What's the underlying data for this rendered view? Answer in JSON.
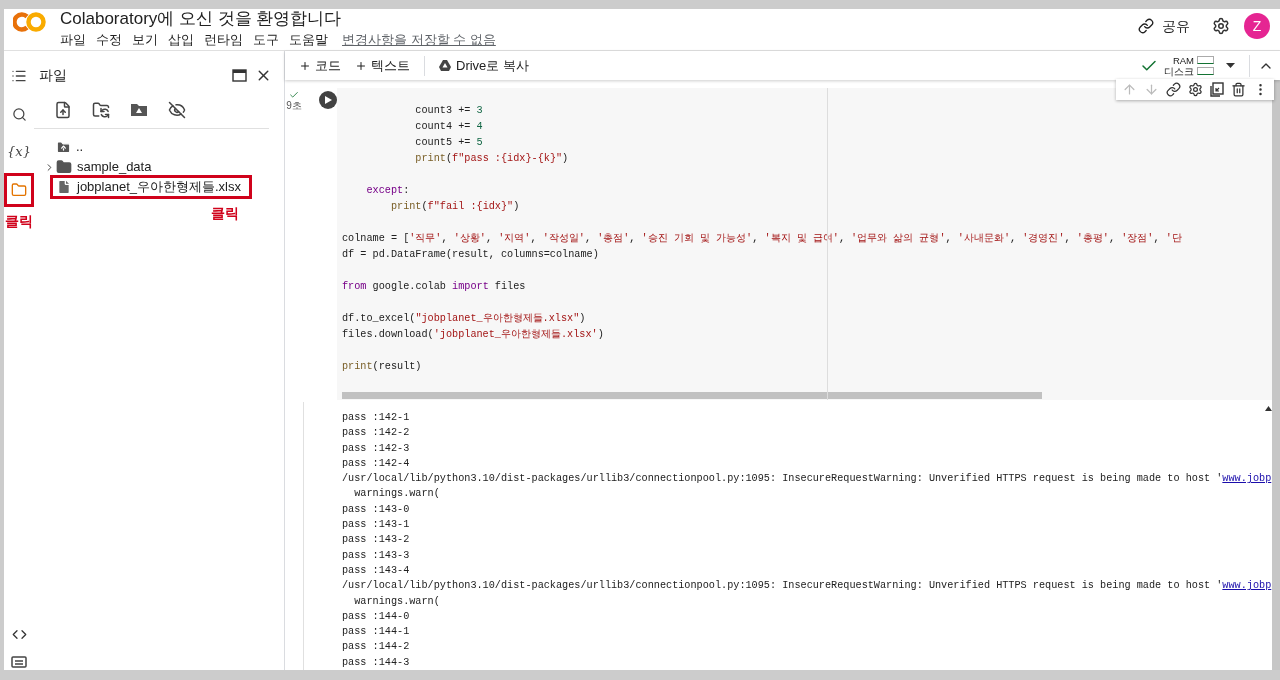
{
  "header": {
    "title": "Colaboratory에 오신 것을 환영합니다",
    "menu": [
      "파일",
      "수정",
      "보기",
      "삽입",
      "런타임",
      "도구",
      "도움말"
    ],
    "save_notice": "변경사항을 저장할 수 없음",
    "share": "공유",
    "avatar": "Z"
  },
  "side_strip": {
    "items": [
      {
        "kind": "toc",
        "selected": false,
        "highlighted": false
      },
      {
        "kind": "search",
        "selected": false,
        "highlighted": false
      },
      {
        "kind": "variables",
        "label": "{x}",
        "selected": false,
        "highlighted": false
      },
      {
        "kind": "files",
        "selected": true,
        "highlighted": true,
        "annotation": "클릭"
      }
    ],
    "bottom": [
      {
        "kind": "code"
      },
      {
        "kind": "terminal"
      }
    ]
  },
  "files_panel": {
    "title": "파일",
    "tree": [
      {
        "kind": "up",
        "name": "..",
        "highlighted": false
      },
      {
        "kind": "folder",
        "name": "sample_data",
        "expanded": false,
        "highlighted": false
      },
      {
        "kind": "file",
        "name": "jobplanet_우아한형제들.xlsx",
        "highlighted": true,
        "annotation": "클릭"
      }
    ]
  },
  "toolbar": {
    "add_code": "코드",
    "add_text": "텍스트",
    "copy_drive": "Drive로 복사",
    "ram": "RAM",
    "disk": "디스크",
    "connected": true
  },
  "cell": {
    "run_time": "9초",
    "done": true,
    "code": [
      {
        "kind": "code",
        "tokens": [
          {
            "kind": "plain",
            "text": "            count3 += "
          },
          {
            "kind": "number",
            "text": "3"
          }
        ]
      },
      {
        "kind": "code",
        "tokens": [
          {
            "kind": "plain",
            "text": "            count4 += "
          },
          {
            "kind": "number",
            "text": "4"
          }
        ]
      },
      {
        "kind": "code",
        "tokens": [
          {
            "kind": "plain",
            "text": "            count5 += "
          },
          {
            "kind": "number",
            "text": "5"
          }
        ]
      },
      {
        "kind": "code",
        "tokens": [
          {
            "kind": "func",
            "text": "            print"
          },
          {
            "kind": "plain",
            "text": "("
          },
          {
            "kind": "string",
            "text": "f\"pass :{idx}-{k}\""
          },
          {
            "kind": "plain",
            "text": ")"
          }
        ]
      },
      {
        "kind": "blank"
      },
      {
        "kind": "code",
        "tokens": [
          {
            "kind": "keyword",
            "text": "    except"
          },
          {
            "kind": "plain",
            "text": ":"
          }
        ]
      },
      {
        "kind": "code",
        "tokens": [
          {
            "kind": "func",
            "text": "        print"
          },
          {
            "kind": "plain",
            "text": "("
          },
          {
            "kind": "string",
            "text": "f\"fail :{idx}\""
          },
          {
            "kind": "plain",
            "text": ")"
          }
        ]
      },
      {
        "kind": "blank"
      },
      {
        "kind": "code",
        "tokens": [
          {
            "kind": "plain",
            "text": "colname = ["
          },
          {
            "kind": "string",
            "text": "'직무'"
          },
          {
            "kind": "plain",
            "text": ", "
          },
          {
            "kind": "string",
            "text": "'상황'"
          },
          {
            "kind": "plain",
            "text": ", "
          },
          {
            "kind": "string",
            "text": "'지역'"
          },
          {
            "kind": "plain",
            "text": ", "
          },
          {
            "kind": "string",
            "text": "'작성일'"
          },
          {
            "kind": "plain",
            "text": ", "
          },
          {
            "kind": "string",
            "text": "'총점'"
          },
          {
            "kind": "plain",
            "text": ", "
          },
          {
            "kind": "string",
            "text": "'승진 기회 및 가능성'"
          },
          {
            "kind": "plain",
            "text": ", "
          },
          {
            "kind": "string",
            "text": "'복지 및 급여'"
          },
          {
            "kind": "plain",
            "text": ", "
          },
          {
            "kind": "string",
            "text": "'업무와 삶의 균형'"
          },
          {
            "kind": "plain",
            "text": ", "
          },
          {
            "kind": "string",
            "text": "'사내문화'"
          },
          {
            "kind": "plain",
            "text": ", "
          },
          {
            "kind": "string",
            "text": "'경영진'"
          },
          {
            "kind": "plain",
            "text": ", "
          },
          {
            "kind": "string",
            "text": "'총평'"
          },
          {
            "kind": "plain",
            "text": ", "
          },
          {
            "kind": "string",
            "text": "'장점'"
          },
          {
            "kind": "plain",
            "text": ", "
          },
          {
            "kind": "string",
            "text": "'단"
          }
        ]
      },
      {
        "kind": "code",
        "tokens": [
          {
            "kind": "plain",
            "text": "df = pd.DataFrame(result, columns=colname)"
          }
        ]
      },
      {
        "kind": "blank"
      },
      {
        "kind": "code",
        "tokens": [
          {
            "kind": "keyword",
            "text": "from"
          },
          {
            "kind": "plain",
            "text": " google.colab "
          },
          {
            "kind": "keyword",
            "text": "import"
          },
          {
            "kind": "plain",
            "text": " files"
          }
        ]
      },
      {
        "kind": "blank"
      },
      {
        "kind": "code",
        "tokens": [
          {
            "kind": "plain",
            "text": "df.to_excel("
          },
          {
            "kind": "string",
            "text": "\"jobplanet_우아한형제들.xlsx\""
          },
          {
            "kind": "plain",
            "text": ")"
          }
        ]
      },
      {
        "kind": "code",
        "tokens": [
          {
            "kind": "plain",
            "text": "files.download("
          },
          {
            "kind": "string",
            "text": "'jobplanet_우아한형제들.xlsx'"
          },
          {
            "kind": "plain",
            "text": ")"
          }
        ]
      },
      {
        "kind": "blank"
      },
      {
        "kind": "code",
        "tokens": [
          {
            "kind": "func",
            "text": "print"
          },
          {
            "kind": "plain",
            "text": "(result)"
          }
        ]
      }
    ]
  },
  "output": [
    {
      "kind": "text",
      "text": "pass :142-1"
    },
    {
      "kind": "text",
      "text": "pass :142-2"
    },
    {
      "kind": "text",
      "text": "pass :142-3"
    },
    {
      "kind": "text",
      "text": "pass :142-4"
    },
    {
      "kind": "warning",
      "text": "/usr/local/lib/python3.10/dist-packages/urllib3/connectionpool.py:1095: InsecureRequestWarning: Unverified HTTPS request is being made to host '",
      "link": "www.jobp"
    },
    {
      "kind": "text",
      "text": "  warnings.warn("
    },
    {
      "kind": "text",
      "text": "pass :143-0"
    },
    {
      "kind": "text",
      "text": "pass :143-1"
    },
    {
      "kind": "text",
      "text": "pass :143-2"
    },
    {
      "kind": "text",
      "text": "pass :143-3"
    },
    {
      "kind": "text",
      "text": "pass :143-4"
    },
    {
      "kind": "warning",
      "text": "/usr/local/lib/python3.10/dist-packages/urllib3/connectionpool.py:1095: InsecureRequestWarning: Unverified HTTPS request is being made to host '",
      "link": "www.jobp"
    },
    {
      "kind": "text",
      "text": "  warnings.warn("
    },
    {
      "kind": "text",
      "text": "pass :144-0"
    },
    {
      "kind": "text",
      "text": "pass :144-1"
    },
    {
      "kind": "text",
      "text": "pass :144-2"
    },
    {
      "kind": "text",
      "text": "pass :144-3"
    }
  ]
}
